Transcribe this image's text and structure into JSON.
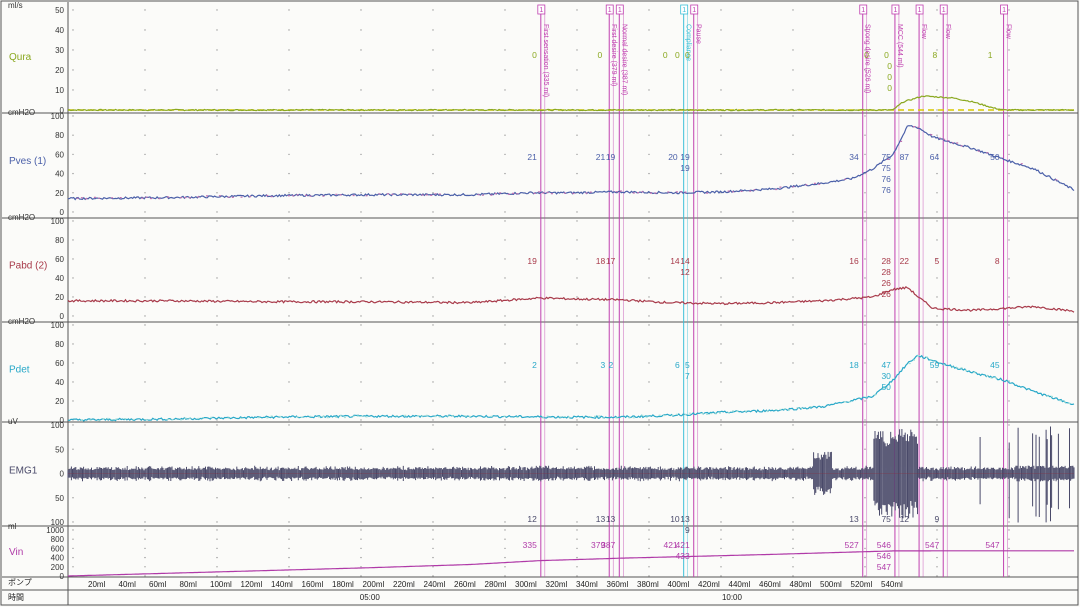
{
  "colors": {
    "grid_dot": "#9a9a9a",
    "border": "#555555",
    "marker_magenta": "#c040b0",
    "marker_cyan": "#3cc0d8",
    "qura": "#8aa820",
    "pves": "#4a5fa8",
    "pves_alt": "#c070b0",
    "pabd": "#a83a4a",
    "pdet": "#28a8c8",
    "pdet_alt": "#a8e0d8",
    "emg": "#4a4a6a",
    "vin": "#b03aa8",
    "zero_line": "#d8c800"
  },
  "channels": [
    {
      "key": "qura",
      "name": "Qura",
      "unit": "ml/s",
      "color": "#8aa820",
      "ticks": [
        "50",
        "40",
        "30",
        "20",
        "10",
        "0"
      ],
      "values": [
        {
          "t": 0.47,
          "text": "0"
        },
        {
          "t": 0.535,
          "text": "0"
        },
        {
          "t": 0.6,
          "text": "0"
        },
        {
          "t": 0.612,
          "text": "0"
        },
        {
          "t": 0.622,
          "text": "0"
        },
        {
          "t": 0.8,
          "text": "0"
        },
        {
          "t": 0.82,
          "text": "0"
        },
        {
          "t": 0.823,
          "text": "0"
        },
        {
          "t": 0.823,
          "text": "0"
        },
        {
          "t": 0.823,
          "text": "0"
        },
        {
          "t": 0.868,
          "text": "8"
        },
        {
          "t": 0.923,
          "text": "1"
        }
      ]
    },
    {
      "key": "pves",
      "name": "Pves (1)",
      "unit": "cmH2O",
      "color": "#4a5fa8",
      "ticks": [
        "100",
        "80",
        "60",
        "40",
        "20",
        "0"
      ],
      "values": [
        {
          "t": 0.47,
          "text": "21"
        },
        {
          "t": 0.538,
          "text": "21"
        },
        {
          "t": 0.548,
          "text": "19"
        },
        {
          "t": 0.61,
          "text": "20"
        },
        {
          "t": 0.622,
          "text": "19"
        },
        {
          "t": 0.622,
          "text": "19"
        },
        {
          "t": 0.79,
          "text": "34"
        },
        {
          "t": 0.822,
          "text": "75"
        },
        {
          "t": 0.822,
          "text": "75"
        },
        {
          "t": 0.822,
          "text": "76"
        },
        {
          "t": 0.822,
          "text": "76"
        },
        {
          "t": 0.84,
          "text": "87"
        },
        {
          "t": 0.87,
          "text": "64"
        },
        {
          "t": 0.93,
          "text": "50"
        }
      ]
    },
    {
      "key": "pabd",
      "name": "Pabd (2)",
      "unit": "cmH2O",
      "color": "#a83a4a",
      "ticks": [
        "100",
        "80",
        "60",
        "40",
        "20",
        "0"
      ],
      "values": [
        {
          "t": 0.47,
          "text": "19"
        },
        {
          "t": 0.538,
          "text": "18"
        },
        {
          "t": 0.548,
          "text": "17"
        },
        {
          "t": 0.612,
          "text": "14"
        },
        {
          "t": 0.622,
          "text": "14"
        },
        {
          "t": 0.622,
          "text": "12"
        },
        {
          "t": 0.79,
          "text": "16"
        },
        {
          "t": 0.822,
          "text": "28"
        },
        {
          "t": 0.822,
          "text": "28"
        },
        {
          "t": 0.822,
          "text": "26"
        },
        {
          "t": 0.822,
          "text": "26"
        },
        {
          "t": 0.84,
          "text": "22"
        },
        {
          "t": 0.87,
          "text": "5"
        },
        {
          "t": 0.93,
          "text": "8"
        }
      ]
    },
    {
      "key": "pdet",
      "name": "Pdet",
      "unit": "cmH2O",
      "color": "#28a8c8",
      "ticks": [
        "100",
        "80",
        "60",
        "40",
        "20",
        "0"
      ],
      "values": [
        {
          "t": 0.47,
          "text": "2"
        },
        {
          "t": 0.538,
          "text": "3"
        },
        {
          "t": 0.546,
          "text": "2"
        },
        {
          "t": 0.612,
          "text": "6"
        },
        {
          "t": 0.622,
          "text": "5"
        },
        {
          "t": 0.622,
          "text": "7"
        },
        {
          "t": 0.79,
          "text": "18"
        },
        {
          "t": 0.822,
          "text": "47"
        },
        {
          "t": 0.822,
          "text": "30"
        },
        {
          "t": 0.822,
          "text": "50"
        },
        {
          "t": 0.87,
          "text": "59"
        },
        {
          "t": 0.93,
          "text": "45"
        }
      ]
    },
    {
      "key": "emg",
      "name": "EMG1",
      "unit": "uV",
      "color": "#4a4a6a",
      "ticks": [
        "100",
        "50",
        "0",
        "50",
        "100"
      ],
      "values": [
        {
          "t": 0.47,
          "text": "12"
        },
        {
          "t": 0.538,
          "text": "13"
        },
        {
          "t": 0.548,
          "text": "13"
        },
        {
          "t": 0.612,
          "text": "10"
        },
        {
          "t": 0.622,
          "text": "13"
        },
        {
          "t": 0.622,
          "text": "9"
        },
        {
          "t": 0.79,
          "text": "13"
        },
        {
          "t": 0.822,
          "text": "75"
        },
        {
          "t": 0.84,
          "text": "12"
        },
        {
          "t": 0.87,
          "text": "9"
        }
      ]
    },
    {
      "key": "vin",
      "name": "Vin",
      "unit": "ml",
      "color": "#b03aa8",
      "ticks": [
        "1000",
        "800",
        "600",
        "400",
        "200",
        "0"
      ],
      "values": [
        {
          "t": 0.47,
          "text": "335"
        },
        {
          "t": 0.538,
          "text": "379"
        },
        {
          "t": 0.548,
          "text": "387"
        },
        {
          "t": 0.61,
          "text": "421"
        },
        {
          "t": 0.622,
          "text": "421"
        },
        {
          "t": 0.622,
          "text": "433"
        },
        {
          "t": 0.79,
          "text": "527"
        },
        {
          "t": 0.822,
          "text": "546"
        },
        {
          "t": 0.822,
          "text": "546"
        },
        {
          "t": 0.822,
          "text": "547"
        },
        {
          "t": 0.87,
          "text": "547"
        },
        {
          "t": 0.93,
          "text": "547"
        }
      ]
    }
  ],
  "events": [
    {
      "t": 0.47,
      "label": "First sensation (335 ml)",
      "color": "magenta",
      "tag": "1"
    },
    {
      "t": 0.538,
      "label": "First desire (379 ml)",
      "color": "magenta",
      "tag": "1"
    },
    {
      "t": 0.548,
      "label": "Normal desire (387 ml)",
      "color": "magenta",
      "tag": "1"
    },
    {
      "t": 0.612,
      "label": "Compliance",
      "color": "cyan",
      "tag": "1"
    },
    {
      "t": 0.622,
      "label": "Pause",
      "color": "magenta",
      "tag": "1"
    },
    {
      "t": 0.79,
      "label": "Strong desire (526 ml)",
      "color": "magenta",
      "tag": "1"
    },
    {
      "t": 0.822,
      "label": "MCC (544 ml)",
      "color": "magenta",
      "tag": "1"
    },
    {
      "t": 0.846,
      "label": "Flow",
      "color": "magenta",
      "tag": "1"
    },
    {
      "t": 0.87,
      "label": "Flow",
      "color": "magenta",
      "tag": "1"
    },
    {
      "t": 0.93,
      "label": "Flow",
      "color": "magenta",
      "tag": "1"
    }
  ],
  "bottom_axis": {
    "pump_label": "ポンプ",
    "time_label": "時間",
    "pump_ticks": [
      "20ml",
      "40ml",
      "60ml",
      "80ml",
      "100ml",
      "120ml",
      "140ml",
      "160ml",
      "180ml",
      "200ml",
      "220ml",
      "240ml",
      "260ml",
      "280ml",
      "300ml",
      "320ml",
      "340ml",
      "360ml",
      "380ml",
      "400ml",
      "420ml",
      "440ml",
      "460ml",
      "480ml",
      "500ml",
      "520ml",
      "540ml"
    ],
    "time_ticks": [
      {
        "t": 0.3,
        "text": "05:00"
      },
      {
        "t": 0.66,
        "text": "10:00"
      }
    ]
  },
  "chart_data": {
    "type": "line",
    "title": "",
    "x_axis": "time (mm:ss)",
    "series": [
      {
        "name": "Qura",
        "unit": "ml/s",
        "ylim": [
          0,
          50
        ],
        "points": [
          [
            0.0,
            0
          ],
          [
            0.82,
            0
          ],
          [
            0.83,
            4
          ],
          [
            0.85,
            7
          ],
          [
            0.88,
            6
          ],
          [
            0.9,
            4
          ],
          [
            0.92,
            1
          ],
          [
            0.93,
            0
          ],
          [
            1.0,
            0
          ]
        ]
      },
      {
        "name": "Pves (1)",
        "unit": "cmH2O",
        "ylim": [
          0,
          100
        ],
        "points": [
          [
            0.0,
            14
          ],
          [
            0.1,
            15
          ],
          [
            0.2,
            17
          ],
          [
            0.3,
            18
          ],
          [
            0.4,
            18
          ],
          [
            0.46,
            20
          ],
          [
            0.5,
            20
          ],
          [
            0.55,
            21
          ],
          [
            0.6,
            20
          ],
          [
            0.65,
            21
          ],
          [
            0.7,
            24
          ],
          [
            0.75,
            30
          ],
          [
            0.78,
            35
          ],
          [
            0.8,
            45
          ],
          [
            0.82,
            60
          ],
          [
            0.83,
            80
          ],
          [
            0.835,
            90
          ],
          [
            0.845,
            88
          ],
          [
            0.86,
            78
          ],
          [
            0.9,
            66
          ],
          [
            0.93,
            55
          ],
          [
            0.96,
            45
          ],
          [
            1.0,
            23
          ]
        ]
      },
      {
        "name": "Pabd (2)",
        "unit": "cmH2O",
        "ylim": [
          0,
          100
        ],
        "points": [
          [
            0.0,
            16
          ],
          [
            0.1,
            16
          ],
          [
            0.2,
            15
          ],
          [
            0.3,
            15
          ],
          [
            0.4,
            14
          ],
          [
            0.47,
            19
          ],
          [
            0.5,
            18
          ],
          [
            0.55,
            17
          ],
          [
            0.6,
            14
          ],
          [
            0.65,
            13
          ],
          [
            0.7,
            14
          ],
          [
            0.75,
            16
          ],
          [
            0.8,
            20
          ],
          [
            0.82,
            28
          ],
          [
            0.835,
            30
          ],
          [
            0.845,
            20
          ],
          [
            0.86,
            8
          ],
          [
            0.9,
            6
          ],
          [
            0.93,
            8
          ],
          [
            0.96,
            10
          ],
          [
            1.0,
            5
          ]
        ]
      },
      {
        "name": "Pdet",
        "unit": "cmH2O",
        "ylim": [
          0,
          100
        ],
        "points": [
          [
            0.0,
            0
          ],
          [
            0.1,
            1
          ],
          [
            0.2,
            3
          ],
          [
            0.3,
            4
          ],
          [
            0.4,
            4
          ],
          [
            0.5,
            3
          ],
          [
            0.55,
            3
          ],
          [
            0.6,
            5
          ],
          [
            0.65,
            8
          ],
          [
            0.7,
            10
          ],
          [
            0.75,
            14
          ],
          [
            0.8,
            25
          ],
          [
            0.82,
            42
          ],
          [
            0.835,
            60
          ],
          [
            0.845,
            68
          ],
          [
            0.87,
            59
          ],
          [
            0.9,
            50
          ],
          [
            0.93,
            42
          ],
          [
            0.96,
            30
          ],
          [
            1.0,
            16
          ]
        ]
      },
      {
        "name": "Vin",
        "unit": "ml",
        "ylim": [
          0,
          1000
        ],
        "points": [
          [
            0.0,
            0
          ],
          [
            0.1,
            60
          ],
          [
            0.2,
            120
          ],
          [
            0.3,
            180
          ],
          [
            0.4,
            250
          ],
          [
            0.47,
            335
          ],
          [
            0.538,
            379
          ],
          [
            0.548,
            387
          ],
          [
            0.612,
            421
          ],
          [
            0.7,
            470
          ],
          [
            0.79,
            527
          ],
          [
            0.822,
            546
          ],
          [
            0.87,
            547
          ],
          [
            1.0,
            547
          ]
        ]
      }
    ]
  }
}
